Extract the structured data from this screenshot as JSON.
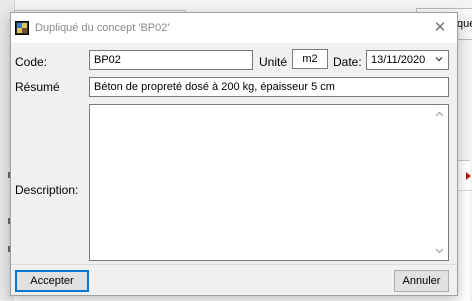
{
  "background": {
    "right_tab_text": "qué"
  },
  "dialog": {
    "title": "Dupliqué du concept 'BP02'",
    "close_glyph": "✕",
    "fields": {
      "code_label": "Code:",
      "code_value": "BP02",
      "unit_label": "Unité",
      "unit_value": "m2",
      "date_label": "Date:",
      "date_value": "13/11/2020",
      "resume_label": "Résumé",
      "resume_value": "Béton de propreté dosé à 200 kg, épaisseur 5 cm",
      "description_label": "Description:",
      "description_value": ""
    },
    "buttons": {
      "accept": "Accepter",
      "cancel": "Annuler"
    },
    "icons": {
      "app": "app-icon",
      "close": "close-icon",
      "dropdown": "chevron-down-icon",
      "scroll_up": "scroll-up-icon",
      "scroll_down": "scroll-down-icon"
    }
  }
}
